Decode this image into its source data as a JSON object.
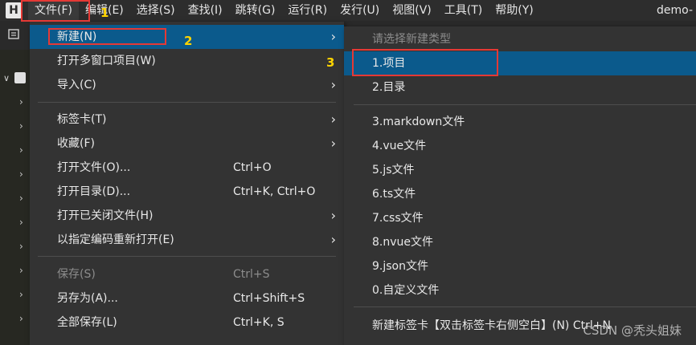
{
  "menubar": {
    "app_icon": "H",
    "items": [
      "文件(F)",
      "编辑(E)",
      "选择(S)",
      "查找(I)",
      "跳转(G)",
      "运行(R)",
      "发行(U)",
      "视图(V)",
      "工具(T)",
      "帮助(Y)"
    ],
    "window_title": "demo-"
  },
  "file_menu": {
    "items": [
      {
        "label": "新建(N)",
        "shortcut": "",
        "submenu": true
      },
      {
        "label": "打开多窗口项目(W)",
        "shortcut": "",
        "submenu": false
      },
      {
        "label": "导入(C)",
        "shortcut": "",
        "submenu": true
      },
      {
        "label": "标签卡(T)",
        "shortcut": "",
        "submenu": true
      },
      {
        "label": "收藏(F)",
        "shortcut": "",
        "submenu": true
      },
      {
        "label": "打开文件(O)...",
        "shortcut": "Ctrl+O",
        "submenu": false
      },
      {
        "label": "打开目录(D)...",
        "shortcut": "Ctrl+K, Ctrl+O",
        "submenu": false
      },
      {
        "label": "打开已关闭文件(H)",
        "shortcut": "",
        "submenu": true
      },
      {
        "label": "以指定编码重新打开(E)",
        "shortcut": "",
        "submenu": true
      },
      {
        "label": "保存(S)",
        "shortcut": "Ctrl+S",
        "submenu": false
      },
      {
        "label": "另存为(A)...",
        "shortcut": "Ctrl+Shift+S",
        "submenu": false
      },
      {
        "label": "全部保存(L)",
        "shortcut": "Ctrl+K, S",
        "submenu": false
      }
    ]
  },
  "new_submenu": {
    "header": "请选择新建类型",
    "items": [
      "1.项目",
      "2.目录",
      "3.markdown文件",
      "4.vue文件",
      "5.js文件",
      "6.ts文件",
      "7.css文件",
      "8.nvue文件",
      "9.json文件",
      "0.自定义文件",
      "新建标签卡【双击标签卡右侧空白】(N)   Ctrl+N"
    ]
  },
  "annotations": {
    "step1": "1",
    "step2": "2",
    "step3": "3"
  },
  "watermark": "CSDN @秃头姐妹",
  "colors": {
    "highlight": "#0b5a8c",
    "annotation_box": "#e53935",
    "annotation_number": "#ffd400"
  }
}
